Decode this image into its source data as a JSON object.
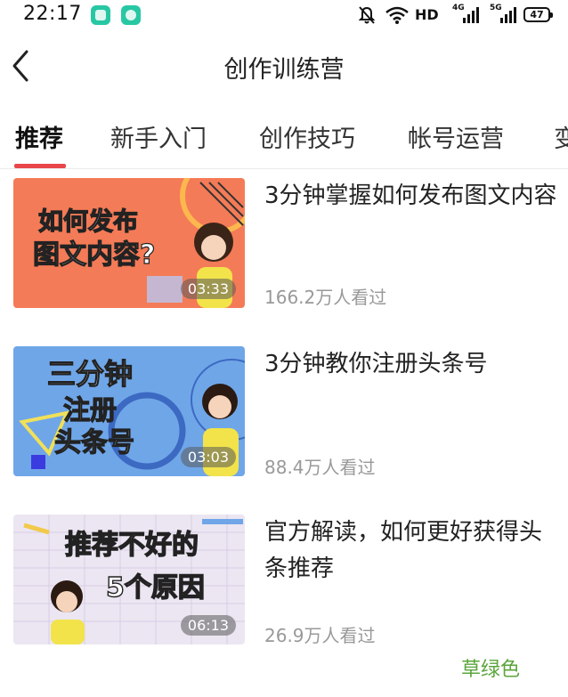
{
  "status_bar": {
    "time": "22:17",
    "network_label": "HD",
    "signal_1_label": "4G",
    "signal_2_label": "5G",
    "battery": "47"
  },
  "header": {
    "title": "创作训练营"
  },
  "tabs": [
    {
      "label": "推荐",
      "active": true
    },
    {
      "label": "新手入门",
      "active": false
    },
    {
      "label": "创作技巧",
      "active": false
    },
    {
      "label": "帐号运营",
      "active": false
    },
    {
      "label": "变",
      "active": false
    }
  ],
  "videos": [
    {
      "title": "3分钟掌握如何发布图文内容",
      "views": "166.2万人看过",
      "duration": "03:33",
      "thumb_text": [
        "如何发布",
        "图文内容?"
      ],
      "thumb_bg": "#f47b57"
    },
    {
      "title": "3分钟教你注册头条号",
      "views": "88.4万人看过",
      "duration": "03:03",
      "thumb_text": [
        "三分钟",
        "注册",
        "头条号"
      ],
      "thumb_bg": "#6fa6e8"
    },
    {
      "title": "官方解读，如何更好获得头条推荐",
      "views": "26.9万人看过",
      "duration": "06:13",
      "thumb_text": [
        "推荐不好的",
        "5个原因"
      ],
      "thumb_bg": "#ece6f2"
    }
  ],
  "watermark": "草绿色",
  "colors": {
    "accent": "#e8464a",
    "watermark": "#5aa53b",
    "subtext": "#999999"
  }
}
